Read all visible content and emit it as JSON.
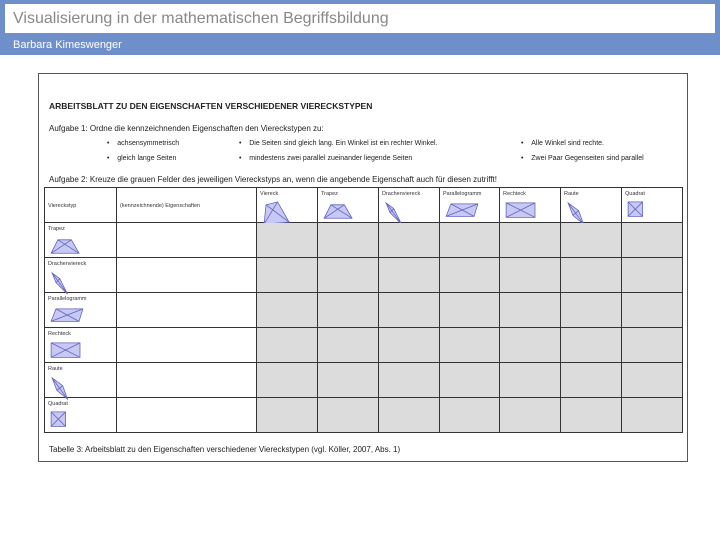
{
  "header": {
    "title": "Visualisierung in der mathematischen Begriffsbildung",
    "author": "Barbara Kimeswenger"
  },
  "worksheet": {
    "heading": "ARBEITSBLATT ZU DEN EIGENSCHAFTEN VERSCHIEDENER VIERECKSTYPEN",
    "task1": "Aufgabe 1: Ordne die kennzeichnenden Eigenschaften den Viereckstypen zu:",
    "properties": [
      "achsensymmetrisch",
      "gleich lange Seiten",
      "Die Seiten sind gleich lang. Ein Winkel ist ein rechter Winkel.",
      "mindestens zwei parallel zueinander liegende Seiten",
      "Alle Winkel sind rechte.",
      "Zwei Paar Gegenseiten sind parallel"
    ],
    "task2": "Aufgabe 2: Kreuze die grauen Felder des jeweiligen Viereckstyps an, wenn die angebende Eigenschaft auch für diesen zutrifft!",
    "table": {
      "col_headers": [
        "Viereckstyp",
        "(kennzeichnende) Eigenschaften",
        "Viereck",
        "Trapez",
        "Drachenviereck",
        "Parallelogramm",
        "Rechteck",
        "Raute",
        "Quadrat"
      ],
      "rows": [
        "Trapez",
        "Drachenviereck",
        "Parallelogramm",
        "Rechteck",
        "Raute",
        "Quadrat"
      ]
    },
    "caption": "Tabelle 3: Arbeitsblatt zu den Eigenschaften verschiedener Viereckstypen (vgl. Köller, 2007, Abs. 1)",
    "shape_fill": "#c8c8f5",
    "shape_stroke": "#6060c0"
  }
}
